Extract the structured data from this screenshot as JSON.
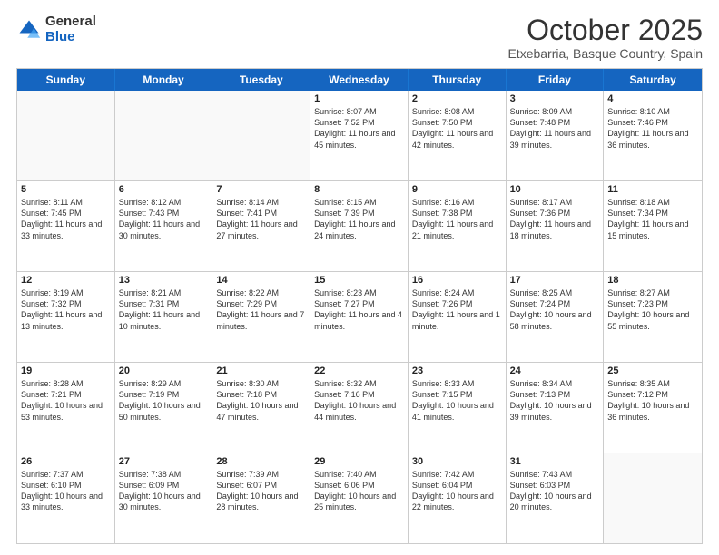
{
  "logo": {
    "general": "General",
    "blue": "Blue"
  },
  "title": "October 2025",
  "location": "Etxebarria, Basque Country, Spain",
  "days": [
    "Sunday",
    "Monday",
    "Tuesday",
    "Wednesday",
    "Thursday",
    "Friday",
    "Saturday"
  ],
  "rows": [
    [
      {
        "day": "",
        "empty": true
      },
      {
        "day": "",
        "empty": true
      },
      {
        "day": "",
        "empty": true
      },
      {
        "day": "1",
        "sunrise": "8:07 AM",
        "sunset": "7:52 PM",
        "daylight": "11 hours and 45 minutes."
      },
      {
        "day": "2",
        "sunrise": "8:08 AM",
        "sunset": "7:50 PM",
        "daylight": "11 hours and 42 minutes."
      },
      {
        "day": "3",
        "sunrise": "8:09 AM",
        "sunset": "7:48 PM",
        "daylight": "11 hours and 39 minutes."
      },
      {
        "day": "4",
        "sunrise": "8:10 AM",
        "sunset": "7:46 PM",
        "daylight": "11 hours and 36 minutes."
      }
    ],
    [
      {
        "day": "5",
        "sunrise": "8:11 AM",
        "sunset": "7:45 PM",
        "daylight": "11 hours and 33 minutes."
      },
      {
        "day": "6",
        "sunrise": "8:12 AM",
        "sunset": "7:43 PM",
        "daylight": "11 hours and 30 minutes."
      },
      {
        "day": "7",
        "sunrise": "8:14 AM",
        "sunset": "7:41 PM",
        "daylight": "11 hours and 27 minutes."
      },
      {
        "day": "8",
        "sunrise": "8:15 AM",
        "sunset": "7:39 PM",
        "daylight": "11 hours and 24 minutes."
      },
      {
        "day": "9",
        "sunrise": "8:16 AM",
        "sunset": "7:38 PM",
        "daylight": "11 hours and 21 minutes."
      },
      {
        "day": "10",
        "sunrise": "8:17 AM",
        "sunset": "7:36 PM",
        "daylight": "11 hours and 18 minutes."
      },
      {
        "day": "11",
        "sunrise": "8:18 AM",
        "sunset": "7:34 PM",
        "daylight": "11 hours and 15 minutes."
      }
    ],
    [
      {
        "day": "12",
        "sunrise": "8:19 AM",
        "sunset": "7:32 PM",
        "daylight": "11 hours and 13 minutes."
      },
      {
        "day": "13",
        "sunrise": "8:21 AM",
        "sunset": "7:31 PM",
        "daylight": "11 hours and 10 minutes."
      },
      {
        "day": "14",
        "sunrise": "8:22 AM",
        "sunset": "7:29 PM",
        "daylight": "11 hours and 7 minutes."
      },
      {
        "day": "15",
        "sunrise": "8:23 AM",
        "sunset": "7:27 PM",
        "daylight": "11 hours and 4 minutes."
      },
      {
        "day": "16",
        "sunrise": "8:24 AM",
        "sunset": "7:26 PM",
        "daylight": "11 hours and 1 minute."
      },
      {
        "day": "17",
        "sunrise": "8:25 AM",
        "sunset": "7:24 PM",
        "daylight": "10 hours and 58 minutes."
      },
      {
        "day": "18",
        "sunrise": "8:27 AM",
        "sunset": "7:23 PM",
        "daylight": "10 hours and 55 minutes."
      }
    ],
    [
      {
        "day": "19",
        "sunrise": "8:28 AM",
        "sunset": "7:21 PM",
        "daylight": "10 hours and 53 minutes."
      },
      {
        "day": "20",
        "sunrise": "8:29 AM",
        "sunset": "7:19 PM",
        "daylight": "10 hours and 50 minutes."
      },
      {
        "day": "21",
        "sunrise": "8:30 AM",
        "sunset": "7:18 PM",
        "daylight": "10 hours and 47 minutes."
      },
      {
        "day": "22",
        "sunrise": "8:32 AM",
        "sunset": "7:16 PM",
        "daylight": "10 hours and 44 minutes."
      },
      {
        "day": "23",
        "sunrise": "8:33 AM",
        "sunset": "7:15 PM",
        "daylight": "10 hours and 41 minutes."
      },
      {
        "day": "24",
        "sunrise": "8:34 AM",
        "sunset": "7:13 PM",
        "daylight": "10 hours and 39 minutes."
      },
      {
        "day": "25",
        "sunrise": "8:35 AM",
        "sunset": "7:12 PM",
        "daylight": "10 hours and 36 minutes."
      }
    ],
    [
      {
        "day": "26",
        "sunrise": "7:37 AM",
        "sunset": "6:10 PM",
        "daylight": "10 hours and 33 minutes."
      },
      {
        "day": "27",
        "sunrise": "7:38 AM",
        "sunset": "6:09 PM",
        "daylight": "10 hours and 30 minutes."
      },
      {
        "day": "28",
        "sunrise": "7:39 AM",
        "sunset": "6:07 PM",
        "daylight": "10 hours and 28 minutes."
      },
      {
        "day": "29",
        "sunrise": "7:40 AM",
        "sunset": "6:06 PM",
        "daylight": "10 hours and 25 minutes."
      },
      {
        "day": "30",
        "sunrise": "7:42 AM",
        "sunset": "6:04 PM",
        "daylight": "10 hours and 22 minutes."
      },
      {
        "day": "31",
        "sunrise": "7:43 AM",
        "sunset": "6:03 PM",
        "daylight": "10 hours and 20 minutes."
      },
      {
        "day": "",
        "empty": true
      }
    ]
  ]
}
